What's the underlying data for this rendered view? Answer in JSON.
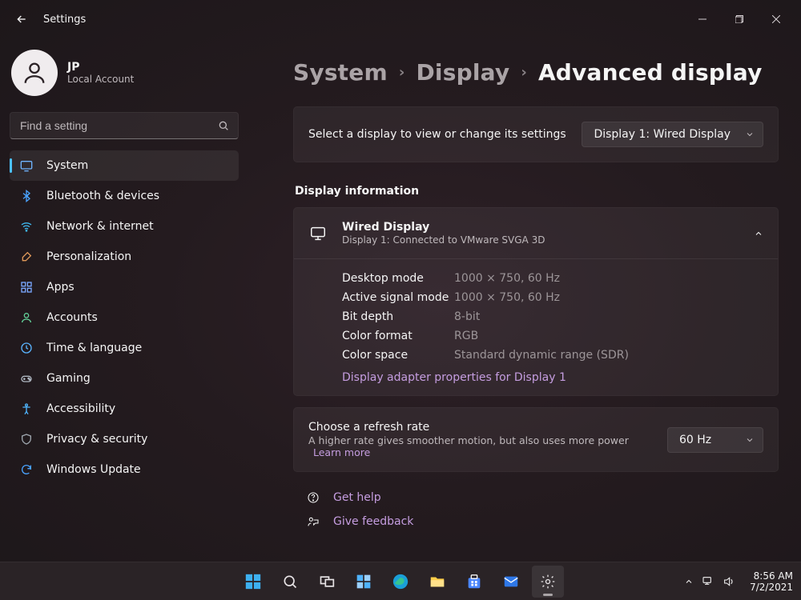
{
  "window": {
    "app_title": "Settings"
  },
  "user": {
    "name": "JP",
    "subtitle": "Local Account"
  },
  "search": {
    "placeholder": "Find a setting"
  },
  "nav": {
    "items": [
      {
        "icon": "display-icon",
        "label": "System",
        "selected": true
      },
      {
        "icon": "bluetooth-icon",
        "label": "Bluetooth & devices",
        "selected": false
      },
      {
        "icon": "wifi-icon",
        "label": "Network & internet",
        "selected": false
      },
      {
        "icon": "brush-icon",
        "label": "Personalization",
        "selected": false
      },
      {
        "icon": "apps-icon",
        "label": "Apps",
        "selected": false
      },
      {
        "icon": "person-icon",
        "label": "Accounts",
        "selected": false
      },
      {
        "icon": "globe-icon",
        "label": "Time & language",
        "selected": false
      },
      {
        "icon": "gamepad-icon",
        "label": "Gaming",
        "selected": false
      },
      {
        "icon": "person-arms-icon",
        "label": "Accessibility",
        "selected": false
      },
      {
        "icon": "shield-icon",
        "label": "Privacy & security",
        "selected": false
      },
      {
        "icon": "sync-icon",
        "label": "Windows Update",
        "selected": false
      }
    ]
  },
  "breadcrumb": {
    "level1": "System",
    "level2": "Display",
    "level3": "Advanced display"
  },
  "select_display": {
    "description": "Select a display to view or change its settings",
    "selected": "Display 1: Wired Display"
  },
  "display_info": {
    "section_title": "Display information",
    "title": "Wired Display",
    "subtitle": "Display 1: Connected to VMware SVGA 3D",
    "rows": [
      {
        "k": "Desktop mode",
        "v": "1000 × 750, 60 Hz"
      },
      {
        "k": "Active signal mode",
        "v": "1000 × 750, 60 Hz"
      },
      {
        "k": "Bit depth",
        "v": "8-bit"
      },
      {
        "k": "Color format",
        "v": "RGB"
      },
      {
        "k": "Color space",
        "v": "Standard dynamic range (SDR)"
      }
    ],
    "adapter_link": "Display adapter properties for Display 1"
  },
  "refresh": {
    "title": "Choose a refresh rate",
    "subtitle": "A higher rate gives smoother motion, but also uses more power",
    "learn_more": "Learn more",
    "selected": "60 Hz"
  },
  "footer": {
    "get_help": "Get help",
    "give_feedback": "Give feedback"
  },
  "taskbar": {
    "time": "8:56 AM",
    "date": "7/2/2021"
  }
}
